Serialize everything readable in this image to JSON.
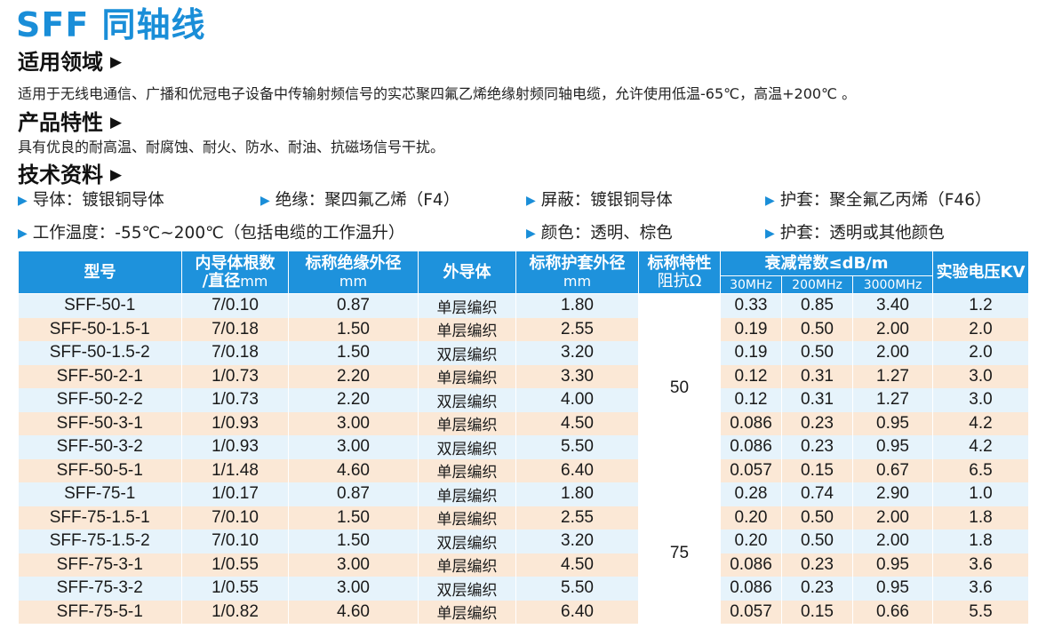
{
  "title": "SFF 同轴线",
  "sections": {
    "application": {
      "heading": "适用领域",
      "text": "适用于无线电通信、广播和优冠电子设备中传输射频信号的实芯聚四氟乙烯绝缘射频同轴电缆，允许使用低温-65℃，高温+200℃ 。"
    },
    "features": {
      "heading": "产品特性",
      "text": "具有优良的耐高温、耐腐蚀、耐火、防水、耐油、抗磁场信号干扰。"
    },
    "technical": {
      "heading": "技术资料",
      "specs_row1": [
        "导体：镀银铜导体",
        "绝缘：聚四氟乙烯（F4）",
        "屏蔽：镀银铜导体",
        "护套：聚全氟乙丙烯（F46）"
      ],
      "specs_row2": [
        "工作温度：-55℃~200℃（包括电缆的工作温升）",
        "颜色：透明、棕色",
        "护套：透明或其他颜色"
      ]
    }
  },
  "arrow_glyph": "▶",
  "triangle_glyph": "▶",
  "table": {
    "headers": {
      "model": "型号",
      "inner_line1": "内导体根数",
      "inner_line2": "/直径",
      "inner_unit": "mm",
      "insulation_line1": "标称绝缘外径",
      "insulation_unit": "mm",
      "outer": "外导体",
      "sheath_line1": "标称护套外径",
      "sheath_unit": "mm",
      "impedance_line1": "标称特性",
      "impedance_line2": "阻抗Ω",
      "attenuation": "衰减常数≤dB/m",
      "freq": [
        "30MHz",
        "200MHz",
        "3000MHz"
      ],
      "voltage": "实验电压KV"
    },
    "impedance_groups": [
      "50",
      "75"
    ],
    "rows": [
      {
        "model": "SFF-50-1",
        "inner": "7/0.10",
        "insulation": "0.87",
        "outer": "单层编织",
        "sheath": "1.80",
        "a30": "0.33",
        "a200": "0.85",
        "a3000": "3.40",
        "voltage": "1.2"
      },
      {
        "model": "SFF-50-1.5-1",
        "inner": "7/0.18",
        "insulation": "1.50",
        "outer": "单层编织",
        "sheath": "2.55",
        "a30": "0.19",
        "a200": "0.50",
        "a3000": "2.00",
        "voltage": "2.0"
      },
      {
        "model": "SFF-50-1.5-2",
        "inner": "7/0.18",
        "insulation": "1.50",
        "outer": "双层编织",
        "sheath": "3.20",
        "a30": "0.19",
        "a200": "0.50",
        "a3000": "2.00",
        "voltage": "2.0"
      },
      {
        "model": "SFF-50-2-1",
        "inner": "1/0.73",
        "insulation": "2.20",
        "outer": "单层编织",
        "sheath": "3.30",
        "a30": "0.12",
        "a200": "0.31",
        "a3000": "1.27",
        "voltage": "3.0"
      },
      {
        "model": "SFF-50-2-2",
        "inner": "1/0.73",
        "insulation": "2.20",
        "outer": "双层编织",
        "sheath": "4.00",
        "a30": "0.12",
        "a200": "0.31",
        "a3000": "1.27",
        "voltage": "3.0"
      },
      {
        "model": "SFF-50-3-1",
        "inner": "1/0.93",
        "insulation": "3.00",
        "outer": "单层编织",
        "sheath": "4.50",
        "a30": "0.086",
        "a200": "0.23",
        "a3000": "0.95",
        "voltage": "4.2"
      },
      {
        "model": "SFF-50-3-2",
        "inner": "1/0.93",
        "insulation": "3.00",
        "outer": "双层编织",
        "sheath": "5.50",
        "a30": "0.086",
        "a200": "0.23",
        "a3000": "0.95",
        "voltage": "4.2"
      },
      {
        "model": "SFF-50-5-1",
        "inner": "1/1.48",
        "insulation": "4.60",
        "outer": "单层编织",
        "sheath": "6.40",
        "a30": "0.057",
        "a200": "0.15",
        "a3000": "0.67",
        "voltage": "6.5"
      },
      {
        "model": "SFF-75-1",
        "inner": "1/0.17",
        "insulation": "0.87",
        "outer": "单层编织",
        "sheath": "1.80",
        "a30": "0.28",
        "a200": "0.74",
        "a3000": "2.90",
        "voltage": "1.0"
      },
      {
        "model": "SFF-75-1.5-1",
        "inner": "7/0.10",
        "insulation": "1.50",
        "outer": "单层编织",
        "sheath": "2.55",
        "a30": "0.20",
        "a200": "0.50",
        "a3000": "2.00",
        "voltage": "1.8"
      },
      {
        "model": "SFF-75-1.5-2",
        "inner": "7/0.10",
        "insulation": "1.50",
        "outer": "双层编织",
        "sheath": "3.20",
        "a30": "0.20",
        "a200": "0.50",
        "a3000": "2.00",
        "voltage": "1.8"
      },
      {
        "model": "SFF-75-3-1",
        "inner": "1/0.55",
        "insulation": "3.00",
        "outer": "单层编织",
        "sheath": "4.50",
        "a30": "0.086",
        "a200": "0.23",
        "a3000": "0.95",
        "voltage": "3.6"
      },
      {
        "model": "SFF-75-3-2",
        "inner": "1/0.55",
        "insulation": "3.00",
        "outer": "双层编织",
        "sheath": "5.50",
        "a30": "0.086",
        "a200": "0.23",
        "a3000": "0.95",
        "voltage": "3.6"
      },
      {
        "model": "SFF-75-5-1",
        "inner": "1/0.82",
        "insulation": "4.60",
        "outer": "单层编织",
        "sheath": "6.40",
        "a30": "0.057",
        "a200": "0.15",
        "a3000": "0.66",
        "voltage": "5.5"
      }
    ]
  },
  "colors": {
    "accent_blue": "#1e92dc",
    "row_blue": "#e6f3fb",
    "row_peach": "#fbe8d6"
  }
}
